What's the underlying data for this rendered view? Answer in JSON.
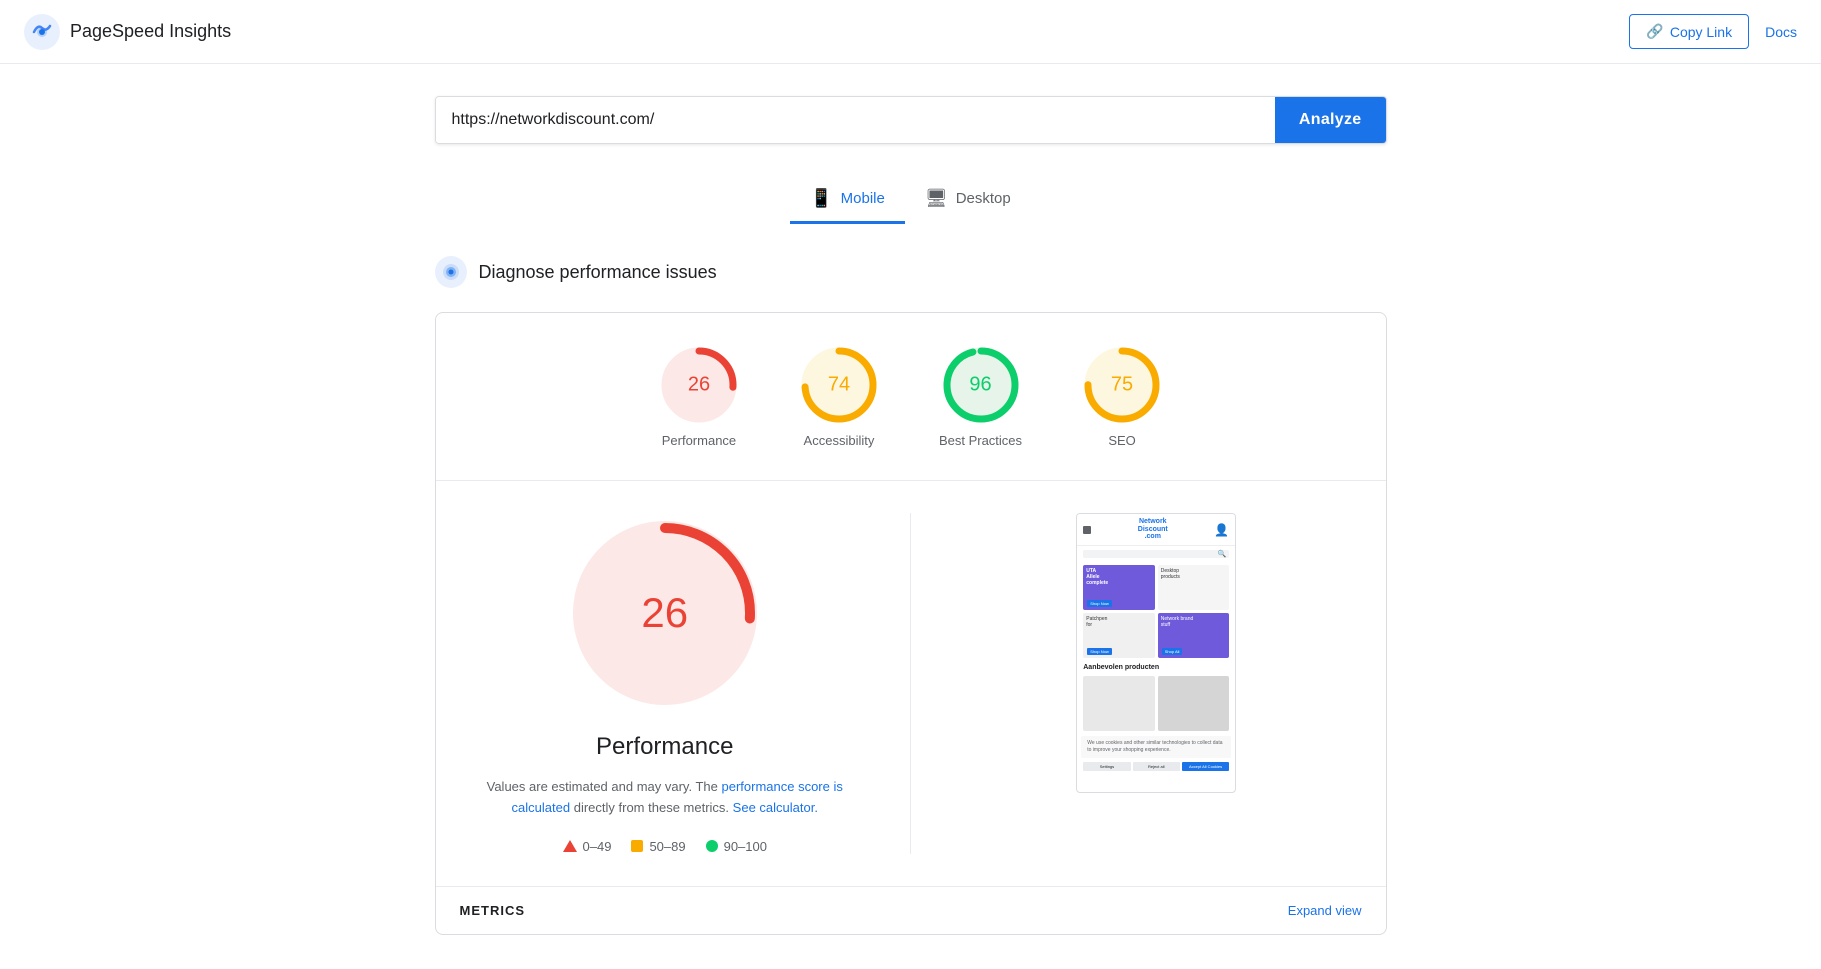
{
  "header": {
    "title": "PageSpeed Insights",
    "copy_link_label": "Copy Link",
    "docs_label": "Docs"
  },
  "url_bar": {
    "value": "https://networkdiscount.com/",
    "analyze_label": "Analyze"
  },
  "tabs": [
    {
      "id": "mobile",
      "label": "Mobile",
      "active": true
    },
    {
      "id": "desktop",
      "label": "Desktop",
      "active": false
    }
  ],
  "diagnose": {
    "text": "Diagnose performance issues"
  },
  "scores": [
    {
      "id": "performance",
      "value": 26,
      "label": "Performance",
      "color": "#ea4335",
      "bg": "#fce8e6",
      "track": "#fce8e6",
      "percent": 26
    },
    {
      "id": "accessibility",
      "value": 74,
      "label": "Accessibility",
      "color": "#f9ab00",
      "bg": "#fef7e0",
      "track": "#fef7e0",
      "percent": 74
    },
    {
      "id": "best-practices",
      "value": 96,
      "label": "Best Practices",
      "color": "#0cce6b",
      "bg": "#e6f4ea",
      "track": "#e6f4ea",
      "percent": 96
    },
    {
      "id": "seo",
      "value": 75,
      "label": "SEO",
      "color": "#f9ab00",
      "bg": "#fef7e0",
      "track": "#fef7e0",
      "percent": 75
    }
  ],
  "performance_detail": {
    "score": 26,
    "title": "Performance",
    "description_1": "Values are estimated and may vary. The",
    "performance_score_link": "performance score is calculated",
    "description_2": "directly from these metrics.",
    "calculator_link": "See calculator.",
    "legend": [
      {
        "type": "triangle",
        "range": "0–49",
        "color": "#ea4335"
      },
      {
        "type": "square",
        "range": "50–89",
        "color": "#f9ab00"
      },
      {
        "type": "circle",
        "range": "90–100",
        "color": "#0cce6b"
      }
    ]
  },
  "bottom_bar": {
    "metrics_label": "METRICS",
    "expand_label": "Expand view"
  }
}
